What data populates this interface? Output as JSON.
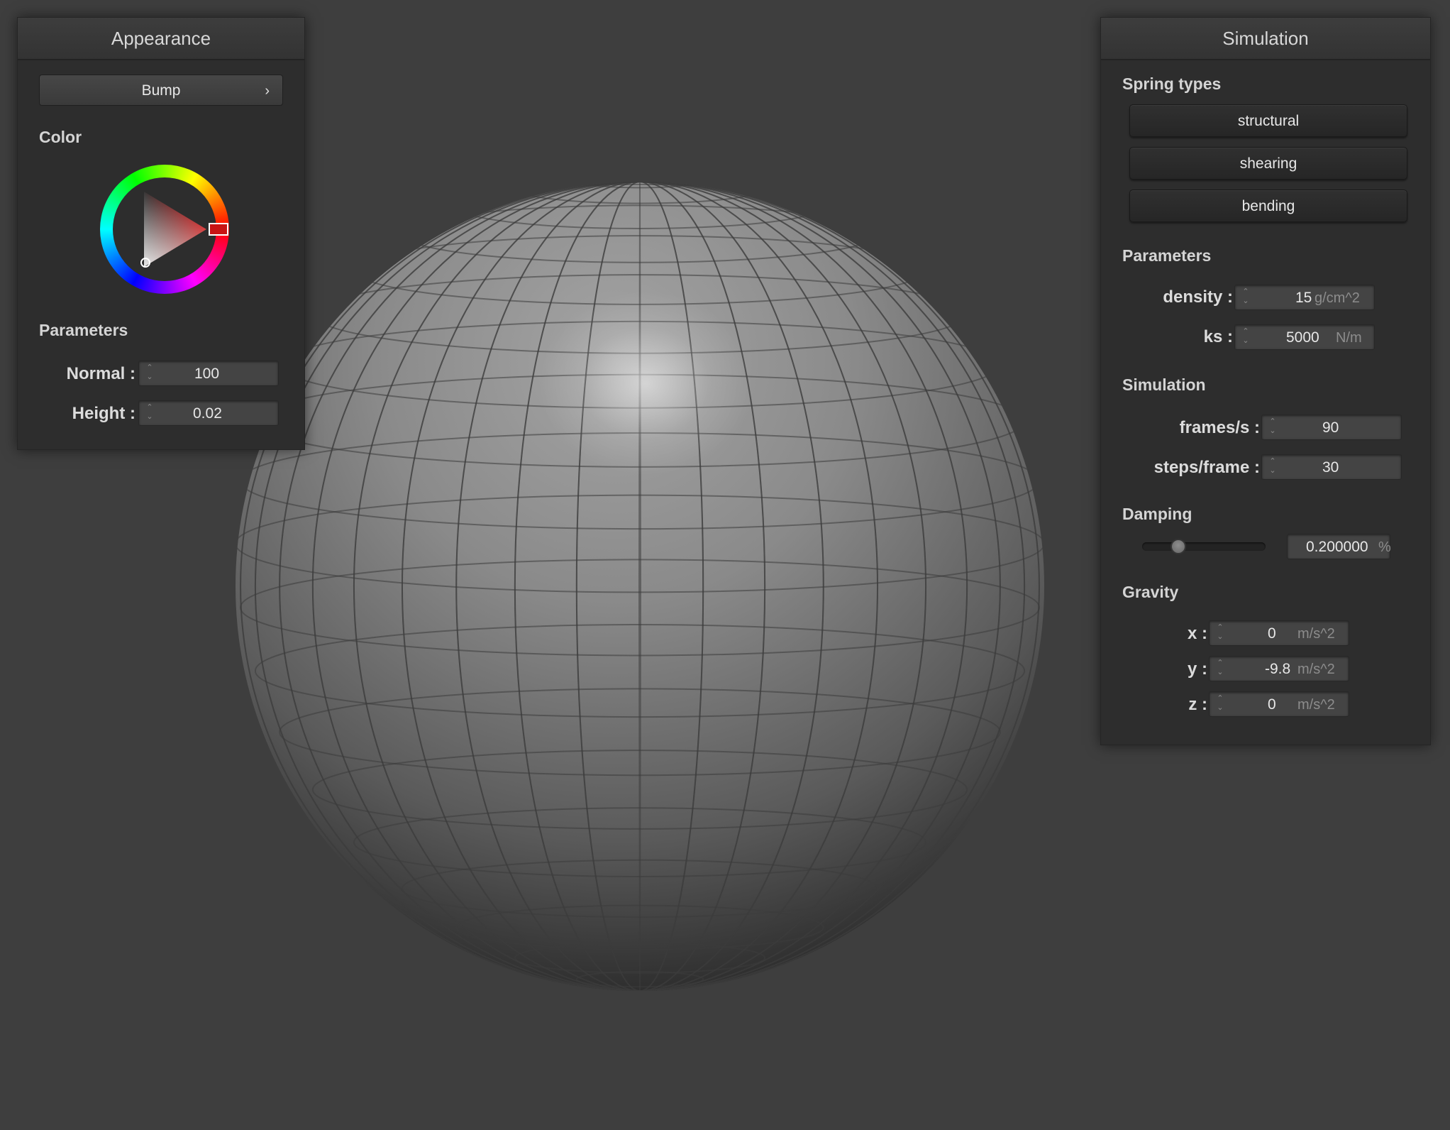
{
  "appearance": {
    "title": "Appearance",
    "shader_button": "Bump",
    "color_label": "Color",
    "color_value": "#c81414",
    "params_label": "Parameters",
    "normal_label": "Normal :",
    "normal_value": "100",
    "height_label": "Height :",
    "height_value": "0.02"
  },
  "simulation": {
    "title": "Simulation",
    "spring_types_label": "Spring types",
    "spring_types": [
      "structural",
      "shearing",
      "bending"
    ],
    "params_label": "Parameters",
    "density_label": "density :",
    "density_value": "15",
    "density_unit": "g/cm^2",
    "ks_label": "ks :",
    "ks_value": "5000",
    "ks_unit": "N/m",
    "sim_label": "Simulation",
    "fps_label": "frames/s :",
    "fps_value": "90",
    "steps_label": "steps/frame :",
    "steps_value": "30",
    "damping_label": "Damping",
    "damping_value": "0.200000",
    "damping_unit": "%",
    "damping_fraction": 0.2,
    "gravity_label": "Gravity",
    "gx_label": "x :",
    "gx_value": "0",
    "gy_label": "y :",
    "gy_value": "-9.8",
    "gz_label": "z :",
    "gz_value": "0",
    "g_unit": "m/s^2"
  },
  "colors": {
    "background": "#3e3e3e",
    "panel": "#2d2d2d",
    "sphere": "#8a8a8a"
  }
}
